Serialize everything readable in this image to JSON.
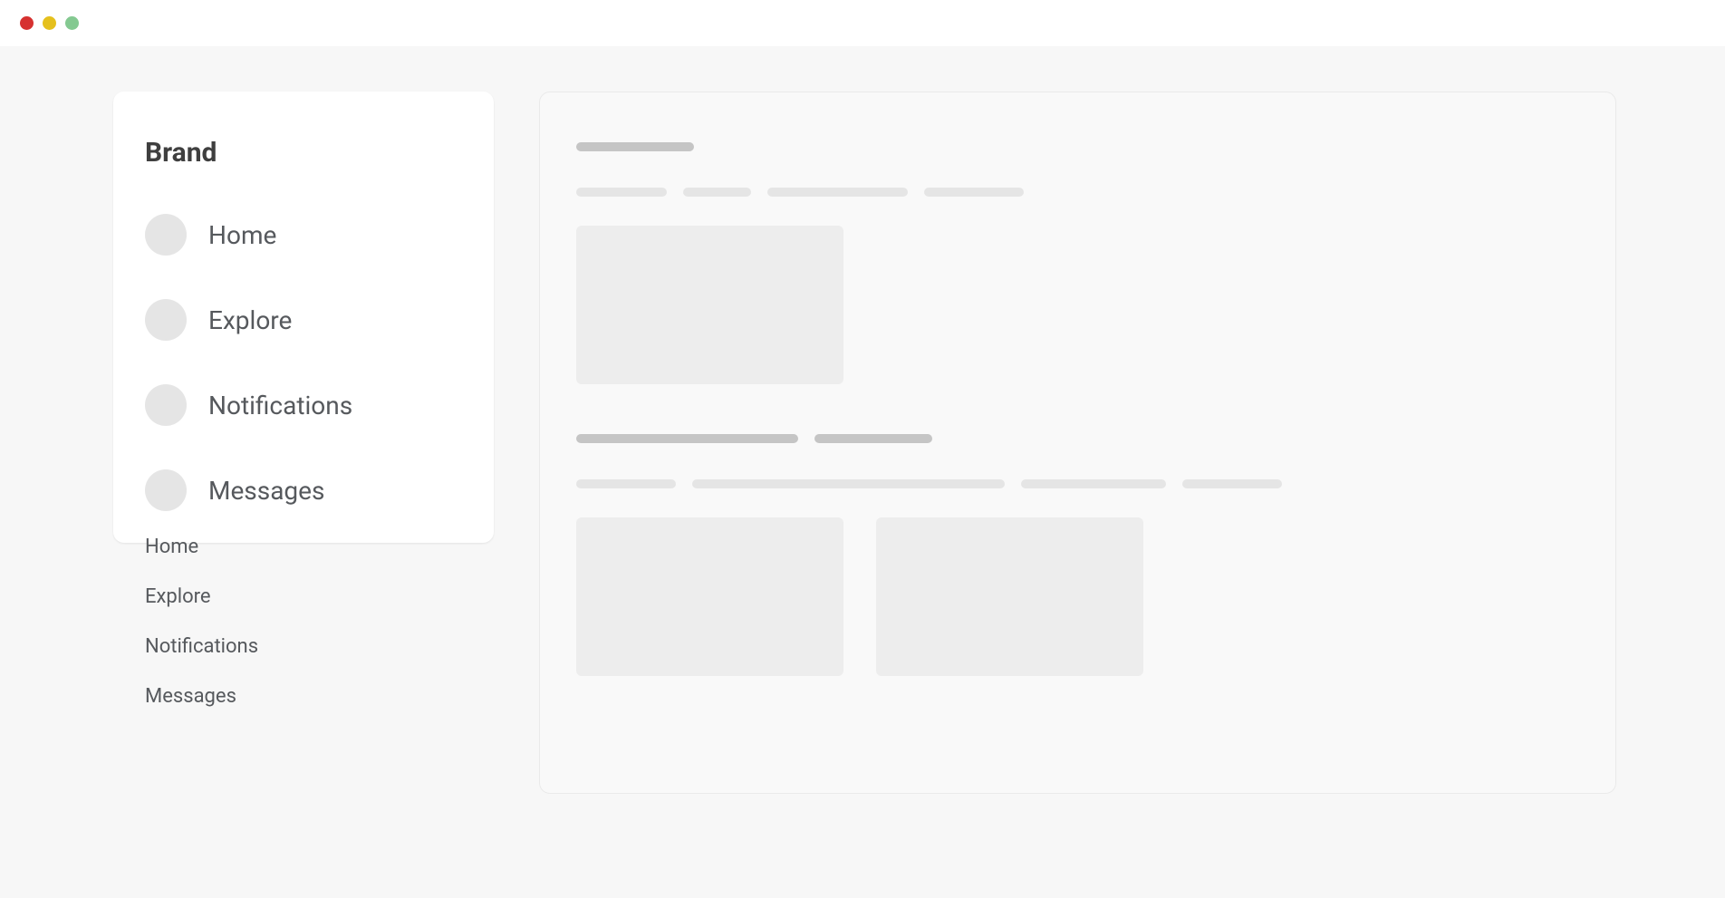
{
  "brand": "Brand",
  "nav": [
    {
      "label": "Home"
    },
    {
      "label": "Explore"
    },
    {
      "label": "Notifications"
    },
    {
      "label": "Messages"
    }
  ],
  "secondary_nav": [
    {
      "label": "Home"
    },
    {
      "label": "Explore"
    },
    {
      "label": "Notifications"
    },
    {
      "label": "Messages"
    }
  ]
}
